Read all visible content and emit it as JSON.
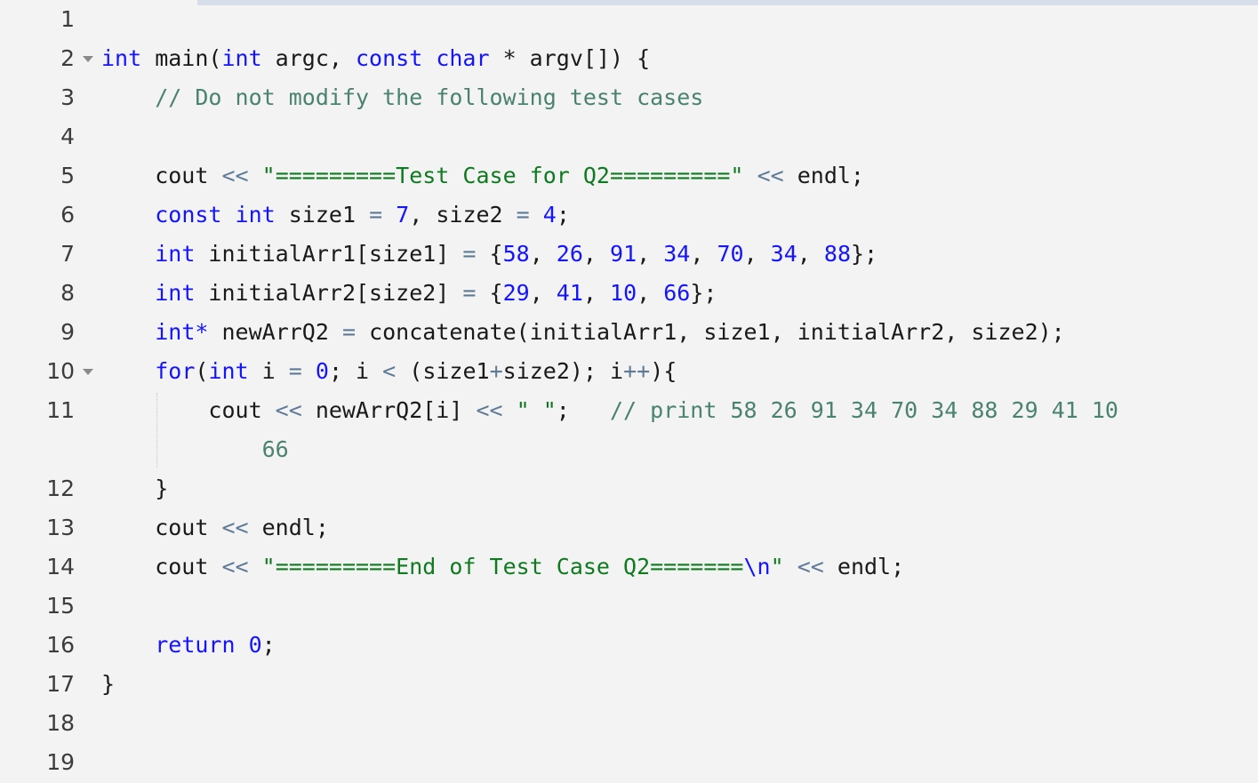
{
  "editor": {
    "language": "C++",
    "theme": "light",
    "font_size_px": 25,
    "colors": {
      "background": "#f3f3f3",
      "gutter_text": "#3c3c3c",
      "plain_text": "#1a1a1a",
      "keyword": "#1414ff",
      "number": "#1414ff",
      "string": "#0f7a1f",
      "escape": "#1414ff",
      "comment": "#4a8270",
      "operator": "#5f7a96",
      "topbar": "#d6dfe9",
      "fold_arrow": "#8a8a8a",
      "indent_guide": "#c3c3c3"
    }
  },
  "lines": [
    {
      "number": "1",
      "foldable": false,
      "indent_guide": false,
      "tokens": []
    },
    {
      "number": "2",
      "foldable": true,
      "indent_guide": false,
      "tokens": [
        {
          "t": "kw",
          "v": "int"
        },
        {
          "t": "pln",
          "v": " main("
        },
        {
          "t": "kw",
          "v": "int"
        },
        {
          "t": "pln",
          "v": " argc, "
        },
        {
          "t": "kw",
          "v": "const"
        },
        {
          "t": "pln",
          "v": " "
        },
        {
          "t": "kw",
          "v": "char"
        },
        {
          "t": "pln",
          "v": " * argv[]) {"
        }
      ]
    },
    {
      "number": "3",
      "foldable": false,
      "indent_guide": false,
      "tokens": [
        {
          "t": "pln",
          "v": "    "
        },
        {
          "t": "cmt",
          "v": "// Do not modify the following test cases"
        }
      ]
    },
    {
      "number": "4",
      "foldable": false,
      "indent_guide": false,
      "tokens": []
    },
    {
      "number": "5",
      "foldable": false,
      "indent_guide": false,
      "tokens": [
        {
          "t": "pln",
          "v": "    cout "
        },
        {
          "t": "op",
          "v": "<<"
        },
        {
          "t": "pln",
          "v": " "
        },
        {
          "t": "str",
          "v": "\"=========Test Case for Q2=========\""
        },
        {
          "t": "pln",
          "v": " "
        },
        {
          "t": "op",
          "v": "<<"
        },
        {
          "t": "pln",
          "v": " endl;"
        }
      ]
    },
    {
      "number": "6",
      "foldable": false,
      "indent_guide": false,
      "tokens": [
        {
          "t": "pln",
          "v": "    "
        },
        {
          "t": "kw",
          "v": "const"
        },
        {
          "t": "pln",
          "v": " "
        },
        {
          "t": "kw",
          "v": "int"
        },
        {
          "t": "pln",
          "v": " size1 "
        },
        {
          "t": "op",
          "v": "="
        },
        {
          "t": "pln",
          "v": " "
        },
        {
          "t": "num",
          "v": "7"
        },
        {
          "t": "pln",
          "v": ", size2 "
        },
        {
          "t": "op",
          "v": "="
        },
        {
          "t": "pln",
          "v": " "
        },
        {
          "t": "num",
          "v": "4"
        },
        {
          "t": "pln",
          "v": ";"
        }
      ]
    },
    {
      "number": "7",
      "foldable": false,
      "indent_guide": false,
      "tokens": [
        {
          "t": "pln",
          "v": "    "
        },
        {
          "t": "kw",
          "v": "int"
        },
        {
          "t": "pln",
          "v": " initialArr1[size1] "
        },
        {
          "t": "op",
          "v": "="
        },
        {
          "t": "pln",
          "v": " {"
        },
        {
          "t": "num",
          "v": "58"
        },
        {
          "t": "pln",
          "v": ", "
        },
        {
          "t": "num",
          "v": "26"
        },
        {
          "t": "pln",
          "v": ", "
        },
        {
          "t": "num",
          "v": "91"
        },
        {
          "t": "pln",
          "v": ", "
        },
        {
          "t": "num",
          "v": "34"
        },
        {
          "t": "pln",
          "v": ", "
        },
        {
          "t": "num",
          "v": "70"
        },
        {
          "t": "pln",
          "v": ", "
        },
        {
          "t": "num",
          "v": "34"
        },
        {
          "t": "pln",
          "v": ", "
        },
        {
          "t": "num",
          "v": "88"
        },
        {
          "t": "pln",
          "v": "};"
        }
      ]
    },
    {
      "number": "8",
      "foldable": false,
      "indent_guide": false,
      "tokens": [
        {
          "t": "pln",
          "v": "    "
        },
        {
          "t": "kw",
          "v": "int"
        },
        {
          "t": "pln",
          "v": " initialArr2[size2] "
        },
        {
          "t": "op",
          "v": "="
        },
        {
          "t": "pln",
          "v": " {"
        },
        {
          "t": "num",
          "v": "29"
        },
        {
          "t": "pln",
          "v": ", "
        },
        {
          "t": "num",
          "v": "41"
        },
        {
          "t": "pln",
          "v": ", "
        },
        {
          "t": "num",
          "v": "10"
        },
        {
          "t": "pln",
          "v": ", "
        },
        {
          "t": "num",
          "v": "66"
        },
        {
          "t": "pln",
          "v": "};"
        }
      ]
    },
    {
      "number": "9",
      "foldable": false,
      "indent_guide": false,
      "tokens": [
        {
          "t": "pln",
          "v": "    "
        },
        {
          "t": "kw",
          "v": "int*"
        },
        {
          "t": "pln",
          "v": " newArrQ2 "
        },
        {
          "t": "op",
          "v": "="
        },
        {
          "t": "pln",
          "v": " concatenate(initialArr1, size1, initialArr2, size2);"
        }
      ]
    },
    {
      "number": "10",
      "foldable": true,
      "indent_guide": false,
      "tokens": [
        {
          "t": "pln",
          "v": "    "
        },
        {
          "t": "kw",
          "v": "for"
        },
        {
          "t": "pln",
          "v": "("
        },
        {
          "t": "kw",
          "v": "int"
        },
        {
          "t": "pln",
          "v": " i "
        },
        {
          "t": "op",
          "v": "="
        },
        {
          "t": "pln",
          "v": " "
        },
        {
          "t": "num",
          "v": "0"
        },
        {
          "t": "pln",
          "v": "; i "
        },
        {
          "t": "op",
          "v": "<"
        },
        {
          "t": "pln",
          "v": " (size1"
        },
        {
          "t": "op",
          "v": "+"
        },
        {
          "t": "pln",
          "v": "size2); i"
        },
        {
          "t": "op",
          "v": "++"
        },
        {
          "t": "pln",
          "v": "){"
        }
      ]
    },
    {
      "number": "11",
      "foldable": false,
      "indent_guide": true,
      "wrapped": true,
      "tokens": [
        {
          "t": "pln",
          "v": "        cout "
        },
        {
          "t": "op",
          "v": "<<"
        },
        {
          "t": "pln",
          "v": " newArrQ2[i] "
        },
        {
          "t": "op",
          "v": "<<"
        },
        {
          "t": "pln",
          "v": " "
        },
        {
          "t": "str",
          "v": "\" \""
        },
        {
          "t": "pln",
          "v": ";   "
        },
        {
          "t": "cmt",
          "v": "// print 58 26 91 34 70 34 88 29 41 10"
        }
      ],
      "wrap_tokens": [
        {
          "t": "pln",
          "v": "            "
        },
        {
          "t": "cmt",
          "v": "66"
        }
      ]
    },
    {
      "number": "12",
      "foldable": false,
      "indent_guide": false,
      "tokens": [
        {
          "t": "pln",
          "v": "    }"
        }
      ]
    },
    {
      "number": "13",
      "foldable": false,
      "indent_guide": false,
      "tokens": [
        {
          "t": "pln",
          "v": "    cout "
        },
        {
          "t": "op",
          "v": "<<"
        },
        {
          "t": "pln",
          "v": " endl;"
        }
      ]
    },
    {
      "number": "14",
      "foldable": false,
      "indent_guide": false,
      "tokens": [
        {
          "t": "pln",
          "v": "    cout "
        },
        {
          "t": "op",
          "v": "<<"
        },
        {
          "t": "pln",
          "v": " "
        },
        {
          "t": "str",
          "v": "\"=========End of Test Case Q2======="
        },
        {
          "t": "esc",
          "v": "\\n"
        },
        {
          "t": "str",
          "v": "\""
        },
        {
          "t": "pln",
          "v": " "
        },
        {
          "t": "op",
          "v": "<<"
        },
        {
          "t": "pln",
          "v": " endl;"
        }
      ]
    },
    {
      "number": "15",
      "foldable": false,
      "indent_guide": false,
      "tokens": []
    },
    {
      "number": "16",
      "foldable": false,
      "indent_guide": false,
      "tokens": [
        {
          "t": "pln",
          "v": "    "
        },
        {
          "t": "kw",
          "v": "return"
        },
        {
          "t": "pln",
          "v": " "
        },
        {
          "t": "num",
          "v": "0"
        },
        {
          "t": "pln",
          "v": ";"
        }
      ]
    },
    {
      "number": "17",
      "foldable": false,
      "indent_guide": false,
      "tokens": [
        {
          "t": "pln",
          "v": "}"
        }
      ]
    },
    {
      "number": "18",
      "foldable": false,
      "indent_guide": false,
      "tokens": []
    },
    {
      "number": "19",
      "foldable": false,
      "indent_guide": false,
      "tokens": []
    }
  ]
}
